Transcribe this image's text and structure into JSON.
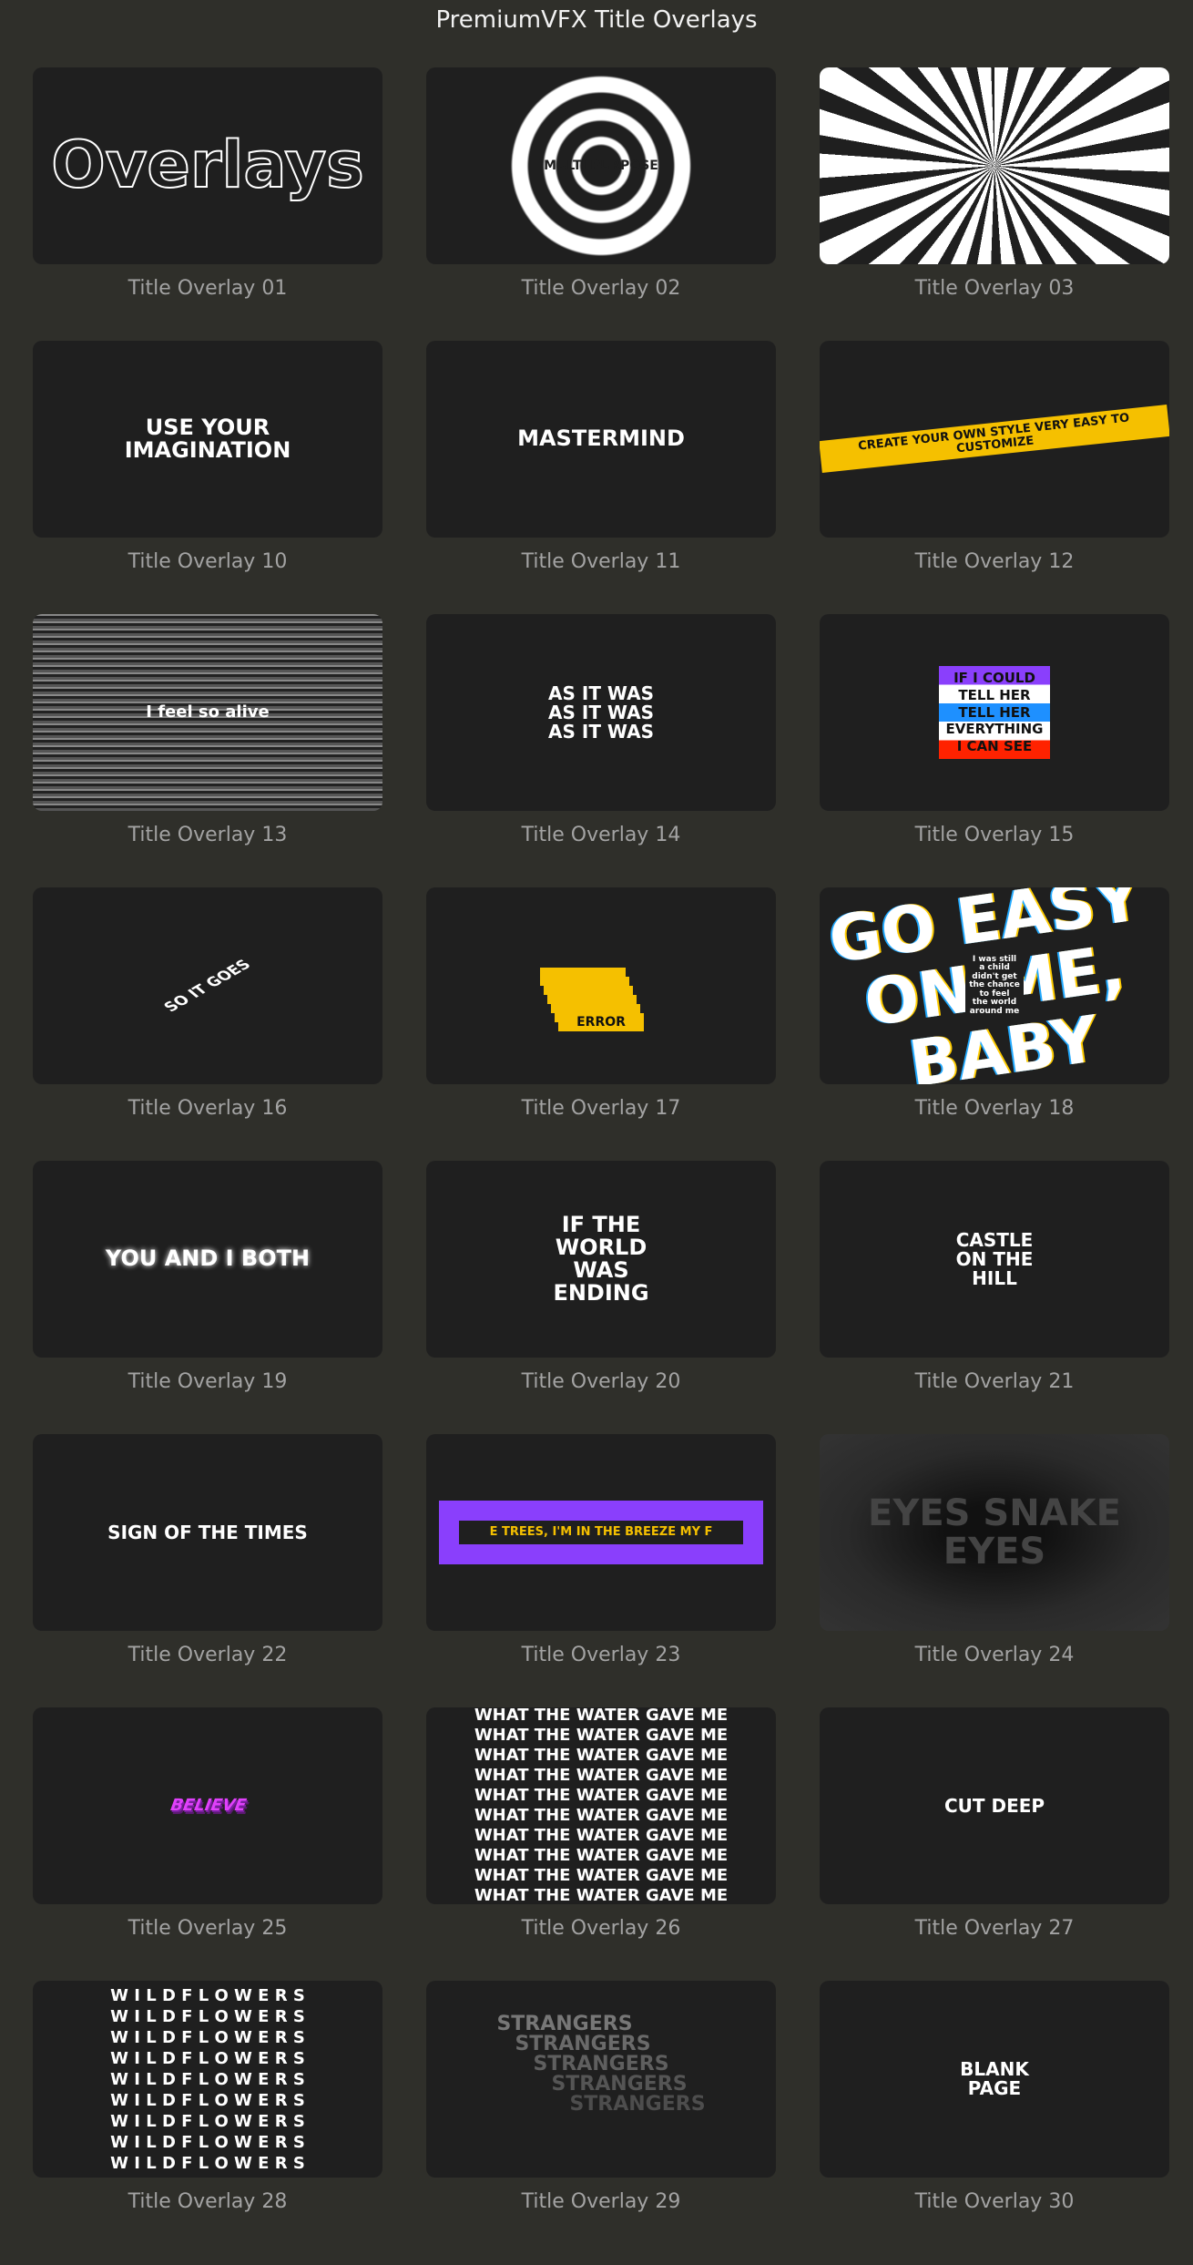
{
  "window": {
    "title": "PremiumVFX Title Overlays"
  },
  "items": [
    {
      "label": "Title Overlay 01",
      "thumb_text": "Overlays",
      "style": "outline"
    },
    {
      "label": "Title Overlay 02",
      "thumb_text": "MULTI PURPOSE",
      "style": "spiral"
    },
    {
      "label": "Title Overlay 03",
      "thumb_text": "",
      "style": "burst"
    },
    {
      "label": "Title Overlay 10",
      "thumb_text": "USE YOUR\nIMAGINATION",
      "style": "plain"
    },
    {
      "label": "Title Overlay 11",
      "thumb_text": "MASTERMIND",
      "style": "plain"
    },
    {
      "label": "Title Overlay 12",
      "thumb_text": "CREATE YOUR OWN STYLE VERY EASY TO CUSTOMIZE",
      "style": "tape"
    },
    {
      "label": "Title Overlay 13",
      "thumb_text": "I feel so alive",
      "style": "noise"
    },
    {
      "label": "Title Overlay 14",
      "thumb_text": "AS IT WAS\nAS IT WAS\nAS IT WAS",
      "style": "plain-small"
    },
    {
      "label": "Title Overlay 15",
      "thumb_text": "IF I COULD\nTELL HER\nTELL HER\nEVERYTHING\nI CAN SEE",
      "style": "stripes"
    },
    {
      "label": "Title Overlay 16",
      "thumb_text": "SO IT GOES",
      "style": "wave"
    },
    {
      "label": "Title Overlay 17",
      "thumb_text": "ERROR",
      "style": "error"
    },
    {
      "label": "Title Overlay 18",
      "thumb_text": "GO EASY ON ME, BABY",
      "sub_text": "I was still\na child\ndidn't get\nthe chance\nto feel\nthe world\naround me",
      "style": "big"
    },
    {
      "label": "Title Overlay 19",
      "thumb_text": "YOU AND I BOTH",
      "style": "blur"
    },
    {
      "label": "Title Overlay 20",
      "thumb_text": "IF THE\nWORLD\nWAS\nENDING",
      "style": "plain"
    },
    {
      "label": "Title Overlay 21",
      "thumb_text": "CASTLE\nON THE\nHILL",
      "style": "plain-small"
    },
    {
      "label": "Title Overlay 22",
      "thumb_text": "SIGN OF THE TIMES",
      "style": "plain-small"
    },
    {
      "label": "Title Overlay 23",
      "thumb_text": "E TREES, I'M IN THE BREEZE MY F",
      "style": "frame"
    },
    {
      "label": "Title Overlay 24",
      "thumb_text": "EYES  SNAKE  EYES",
      "style": "tunnel"
    },
    {
      "label": "Title Overlay 25",
      "thumb_text": "BELIEVE",
      "style": "pink"
    },
    {
      "label": "Title Overlay 26",
      "thumb_text": "WHAT THE WATER GAVE ME",
      "style": "repeat"
    },
    {
      "label": "Title Overlay 27",
      "thumb_text": "CUT DEEP",
      "style": "plain-small"
    },
    {
      "label": "Title Overlay 28",
      "thumb_text": "W I L D F L O W E R S",
      "style": "repeat-spaced"
    },
    {
      "label": "Title Overlay 29",
      "thumb_text": "STRANGERS",
      "style": "stairs"
    },
    {
      "label": "Title Overlay 30",
      "thumb_text": "BLANK\nPAGE",
      "style": "plain-small"
    }
  ],
  "colors": {
    "background": "#2f2f2a",
    "card": "#1f1f1f",
    "label": "#a3a3a3",
    "tape": "#f5c000",
    "purple": "#8a3ffc",
    "blue": "#1e90ff",
    "red": "#ff2200"
  }
}
